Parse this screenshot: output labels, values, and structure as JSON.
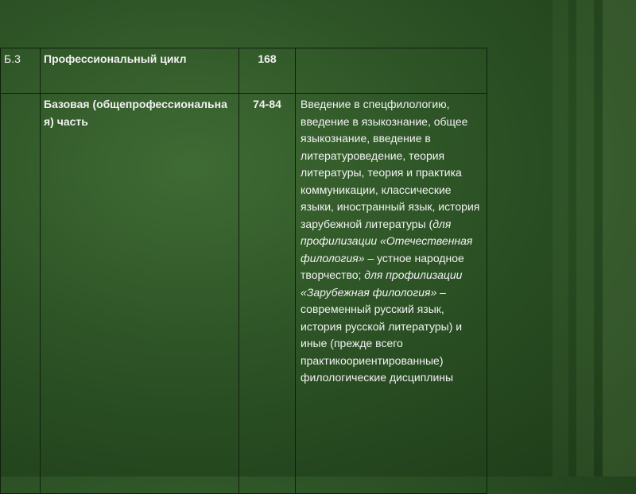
{
  "table": {
    "row1": {
      "code": "Б.3",
      "name": "Профессиональный цикл",
      "credits": "168",
      "description": ""
    },
    "row2": {
      "code": "",
      "name": "Базовая (общепрофессиональная) часть",
      "credits": "74-84",
      "description": {
        "part1": "Введение в спецфилологию, введение в языкознание, общее языкознание, введение в литературоведение, теория литературы, теория и практика коммуникации, классические языки, иностранный язык, история зарубежной литературы (",
        "italic1": "для профилизации «Отечественная филология»",
        "part2": " – устное народное творчество; ",
        "italic2": "для профилизации «Зарубежная филология»",
        "part3": " – современный русский язык, история русской литературы) и иные (прежде всего практикоориентированные) филологические дисциплины"
      }
    }
  }
}
